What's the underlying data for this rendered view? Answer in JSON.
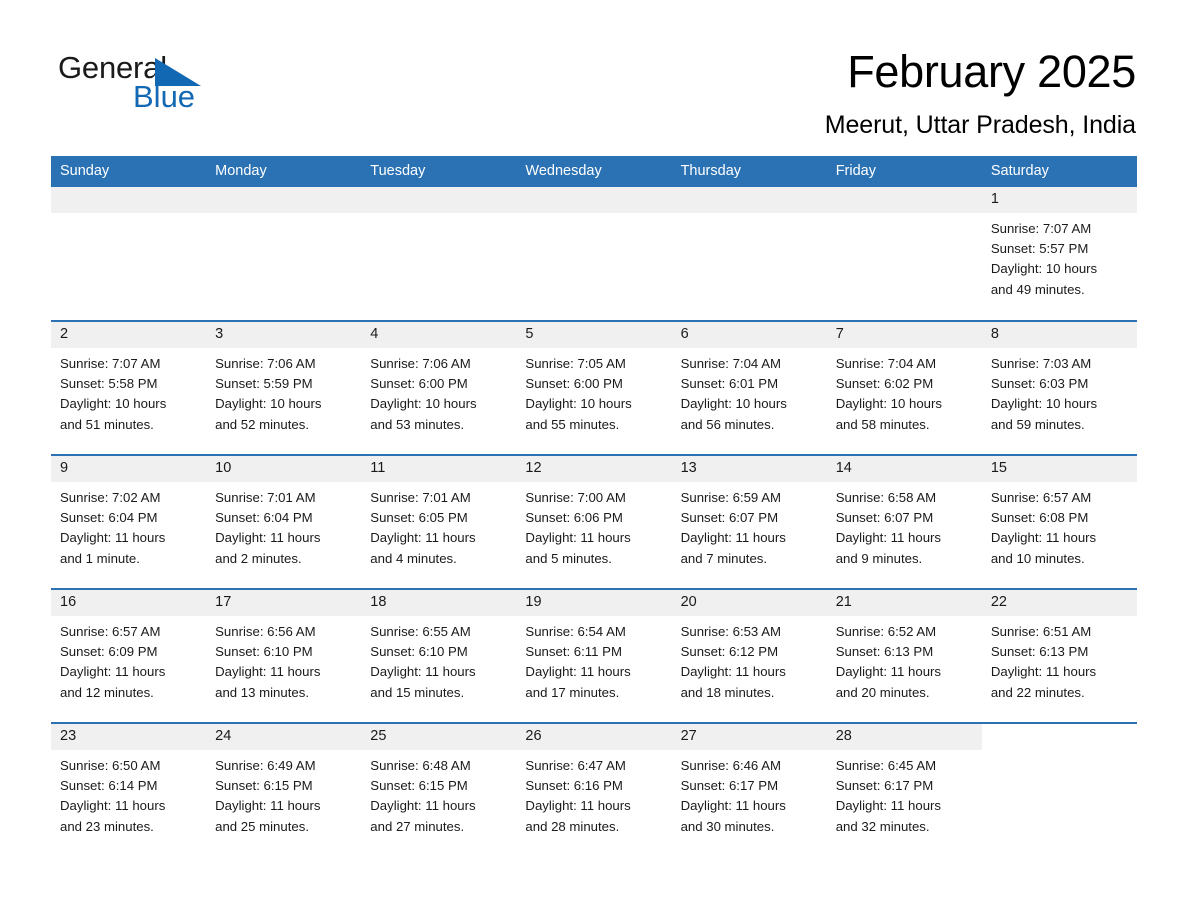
{
  "brand": {
    "name_part1": "General",
    "name_part2": "Blue",
    "triangle_color": "#1268b3",
    "icon": "triangle-logo-icon"
  },
  "header": {
    "month_title": "February 2025",
    "location": "Meerut, Uttar Pradesh, India"
  },
  "theme": {
    "header_blue": "#2b72b4",
    "daynum_gray": "#f0f0f0",
    "cell_white": "#ffffff",
    "text": "#1a1a1a"
  },
  "calendar": {
    "weekday_headers": [
      "Sunday",
      "Monday",
      "Tuesday",
      "Wednesday",
      "Thursday",
      "Friday",
      "Saturday"
    ],
    "weeks": [
      [
        {
          "day": "",
          "sunrise": "",
          "sunset": "",
          "daylight_line1": "",
          "daylight_line2": "",
          "empty": true
        },
        {
          "day": "",
          "sunrise": "",
          "sunset": "",
          "daylight_line1": "",
          "daylight_line2": "",
          "empty": true
        },
        {
          "day": "",
          "sunrise": "",
          "sunset": "",
          "daylight_line1": "",
          "daylight_line2": "",
          "empty": true
        },
        {
          "day": "",
          "sunrise": "",
          "sunset": "",
          "daylight_line1": "",
          "daylight_line2": "",
          "empty": true
        },
        {
          "day": "",
          "sunrise": "",
          "sunset": "",
          "daylight_line1": "",
          "daylight_line2": "",
          "empty": true
        },
        {
          "day": "",
          "sunrise": "",
          "sunset": "",
          "daylight_line1": "",
          "daylight_line2": "",
          "empty": true
        },
        {
          "day": "1",
          "sunrise": "Sunrise: 7:07 AM",
          "sunset": "Sunset: 5:57 PM",
          "daylight_line1": "Daylight: 10 hours",
          "daylight_line2": "and 49 minutes.",
          "empty": false
        }
      ],
      [
        {
          "day": "2",
          "sunrise": "Sunrise: 7:07 AM",
          "sunset": "Sunset: 5:58 PM",
          "daylight_line1": "Daylight: 10 hours",
          "daylight_line2": "and 51 minutes.",
          "empty": false
        },
        {
          "day": "3",
          "sunrise": "Sunrise: 7:06 AM",
          "sunset": "Sunset: 5:59 PM",
          "daylight_line1": "Daylight: 10 hours",
          "daylight_line2": "and 52 minutes.",
          "empty": false
        },
        {
          "day": "4",
          "sunrise": "Sunrise: 7:06 AM",
          "sunset": "Sunset: 6:00 PM",
          "daylight_line1": "Daylight: 10 hours",
          "daylight_line2": "and 53 minutes.",
          "empty": false
        },
        {
          "day": "5",
          "sunrise": "Sunrise: 7:05 AM",
          "sunset": "Sunset: 6:00 PM",
          "daylight_line1": "Daylight: 10 hours",
          "daylight_line2": "and 55 minutes.",
          "empty": false
        },
        {
          "day": "6",
          "sunrise": "Sunrise: 7:04 AM",
          "sunset": "Sunset: 6:01 PM",
          "daylight_line1": "Daylight: 10 hours",
          "daylight_line2": "and 56 minutes.",
          "empty": false
        },
        {
          "day": "7",
          "sunrise": "Sunrise: 7:04 AM",
          "sunset": "Sunset: 6:02 PM",
          "daylight_line1": "Daylight: 10 hours",
          "daylight_line2": "and 58 minutes.",
          "empty": false
        },
        {
          "day": "8",
          "sunrise": "Sunrise: 7:03 AM",
          "sunset": "Sunset: 6:03 PM",
          "daylight_line1": "Daylight: 10 hours",
          "daylight_line2": "and 59 minutes.",
          "empty": false
        }
      ],
      [
        {
          "day": "9",
          "sunrise": "Sunrise: 7:02 AM",
          "sunset": "Sunset: 6:04 PM",
          "daylight_line1": "Daylight: 11 hours",
          "daylight_line2": "and 1 minute.",
          "empty": false
        },
        {
          "day": "10",
          "sunrise": "Sunrise: 7:01 AM",
          "sunset": "Sunset: 6:04 PM",
          "daylight_line1": "Daylight: 11 hours",
          "daylight_line2": "and 2 minutes.",
          "empty": false
        },
        {
          "day": "11",
          "sunrise": "Sunrise: 7:01 AM",
          "sunset": "Sunset: 6:05 PM",
          "daylight_line1": "Daylight: 11 hours",
          "daylight_line2": "and 4 minutes.",
          "empty": false
        },
        {
          "day": "12",
          "sunrise": "Sunrise: 7:00 AM",
          "sunset": "Sunset: 6:06 PM",
          "daylight_line1": "Daylight: 11 hours",
          "daylight_line2": "and 5 minutes.",
          "empty": false
        },
        {
          "day": "13",
          "sunrise": "Sunrise: 6:59 AM",
          "sunset": "Sunset: 6:07 PM",
          "daylight_line1": "Daylight: 11 hours",
          "daylight_line2": "and 7 minutes.",
          "empty": false
        },
        {
          "day": "14",
          "sunrise": "Sunrise: 6:58 AM",
          "sunset": "Sunset: 6:07 PM",
          "daylight_line1": "Daylight: 11 hours",
          "daylight_line2": "and 9 minutes.",
          "empty": false
        },
        {
          "day": "15",
          "sunrise": "Sunrise: 6:57 AM",
          "sunset": "Sunset: 6:08 PM",
          "daylight_line1": "Daylight: 11 hours",
          "daylight_line2": "and 10 minutes.",
          "empty": false
        }
      ],
      [
        {
          "day": "16",
          "sunrise": "Sunrise: 6:57 AM",
          "sunset": "Sunset: 6:09 PM",
          "daylight_line1": "Daylight: 11 hours",
          "daylight_line2": "and 12 minutes.",
          "empty": false
        },
        {
          "day": "17",
          "sunrise": "Sunrise: 6:56 AM",
          "sunset": "Sunset: 6:10 PM",
          "daylight_line1": "Daylight: 11 hours",
          "daylight_line2": "and 13 minutes.",
          "empty": false
        },
        {
          "day": "18",
          "sunrise": "Sunrise: 6:55 AM",
          "sunset": "Sunset: 6:10 PM",
          "daylight_line1": "Daylight: 11 hours",
          "daylight_line2": "and 15 minutes.",
          "empty": false
        },
        {
          "day": "19",
          "sunrise": "Sunrise: 6:54 AM",
          "sunset": "Sunset: 6:11 PM",
          "daylight_line1": "Daylight: 11 hours",
          "daylight_line2": "and 17 minutes.",
          "empty": false
        },
        {
          "day": "20",
          "sunrise": "Sunrise: 6:53 AM",
          "sunset": "Sunset: 6:12 PM",
          "daylight_line1": "Daylight: 11 hours",
          "daylight_line2": "and 18 minutes.",
          "empty": false
        },
        {
          "day": "21",
          "sunrise": "Sunrise: 6:52 AM",
          "sunset": "Sunset: 6:13 PM",
          "daylight_line1": "Daylight: 11 hours",
          "daylight_line2": "and 20 minutes.",
          "empty": false
        },
        {
          "day": "22",
          "sunrise": "Sunrise: 6:51 AM",
          "sunset": "Sunset: 6:13 PM",
          "daylight_line1": "Daylight: 11 hours",
          "daylight_line2": "and 22 minutes.",
          "empty": false
        }
      ],
      [
        {
          "day": "23",
          "sunrise": "Sunrise: 6:50 AM",
          "sunset": "Sunset: 6:14 PM",
          "daylight_line1": "Daylight: 11 hours",
          "daylight_line2": "and 23 minutes.",
          "empty": false
        },
        {
          "day": "24",
          "sunrise": "Sunrise: 6:49 AM",
          "sunset": "Sunset: 6:15 PM",
          "daylight_line1": "Daylight: 11 hours",
          "daylight_line2": "and 25 minutes.",
          "empty": false
        },
        {
          "day": "25",
          "sunrise": "Sunrise: 6:48 AM",
          "sunset": "Sunset: 6:15 PM",
          "daylight_line1": "Daylight: 11 hours",
          "daylight_line2": "and 27 minutes.",
          "empty": false
        },
        {
          "day": "26",
          "sunrise": "Sunrise: 6:47 AM",
          "sunset": "Sunset: 6:16 PM",
          "daylight_line1": "Daylight: 11 hours",
          "daylight_line2": "and 28 minutes.",
          "empty": false
        },
        {
          "day": "27",
          "sunrise": "Sunrise: 6:46 AM",
          "sunset": "Sunset: 6:17 PM",
          "daylight_line1": "Daylight: 11 hours",
          "daylight_line2": "and 30 minutes.",
          "empty": false
        },
        {
          "day": "28",
          "sunrise": "Sunrise: 6:45 AM",
          "sunset": "Sunset: 6:17 PM",
          "daylight_line1": "Daylight: 11 hours",
          "daylight_line2": "and 32 minutes.",
          "empty": false
        },
        {
          "day": "",
          "sunrise": "",
          "sunset": "",
          "daylight_line1": "",
          "daylight_line2": "",
          "empty": true,
          "outside": true
        }
      ]
    ]
  }
}
